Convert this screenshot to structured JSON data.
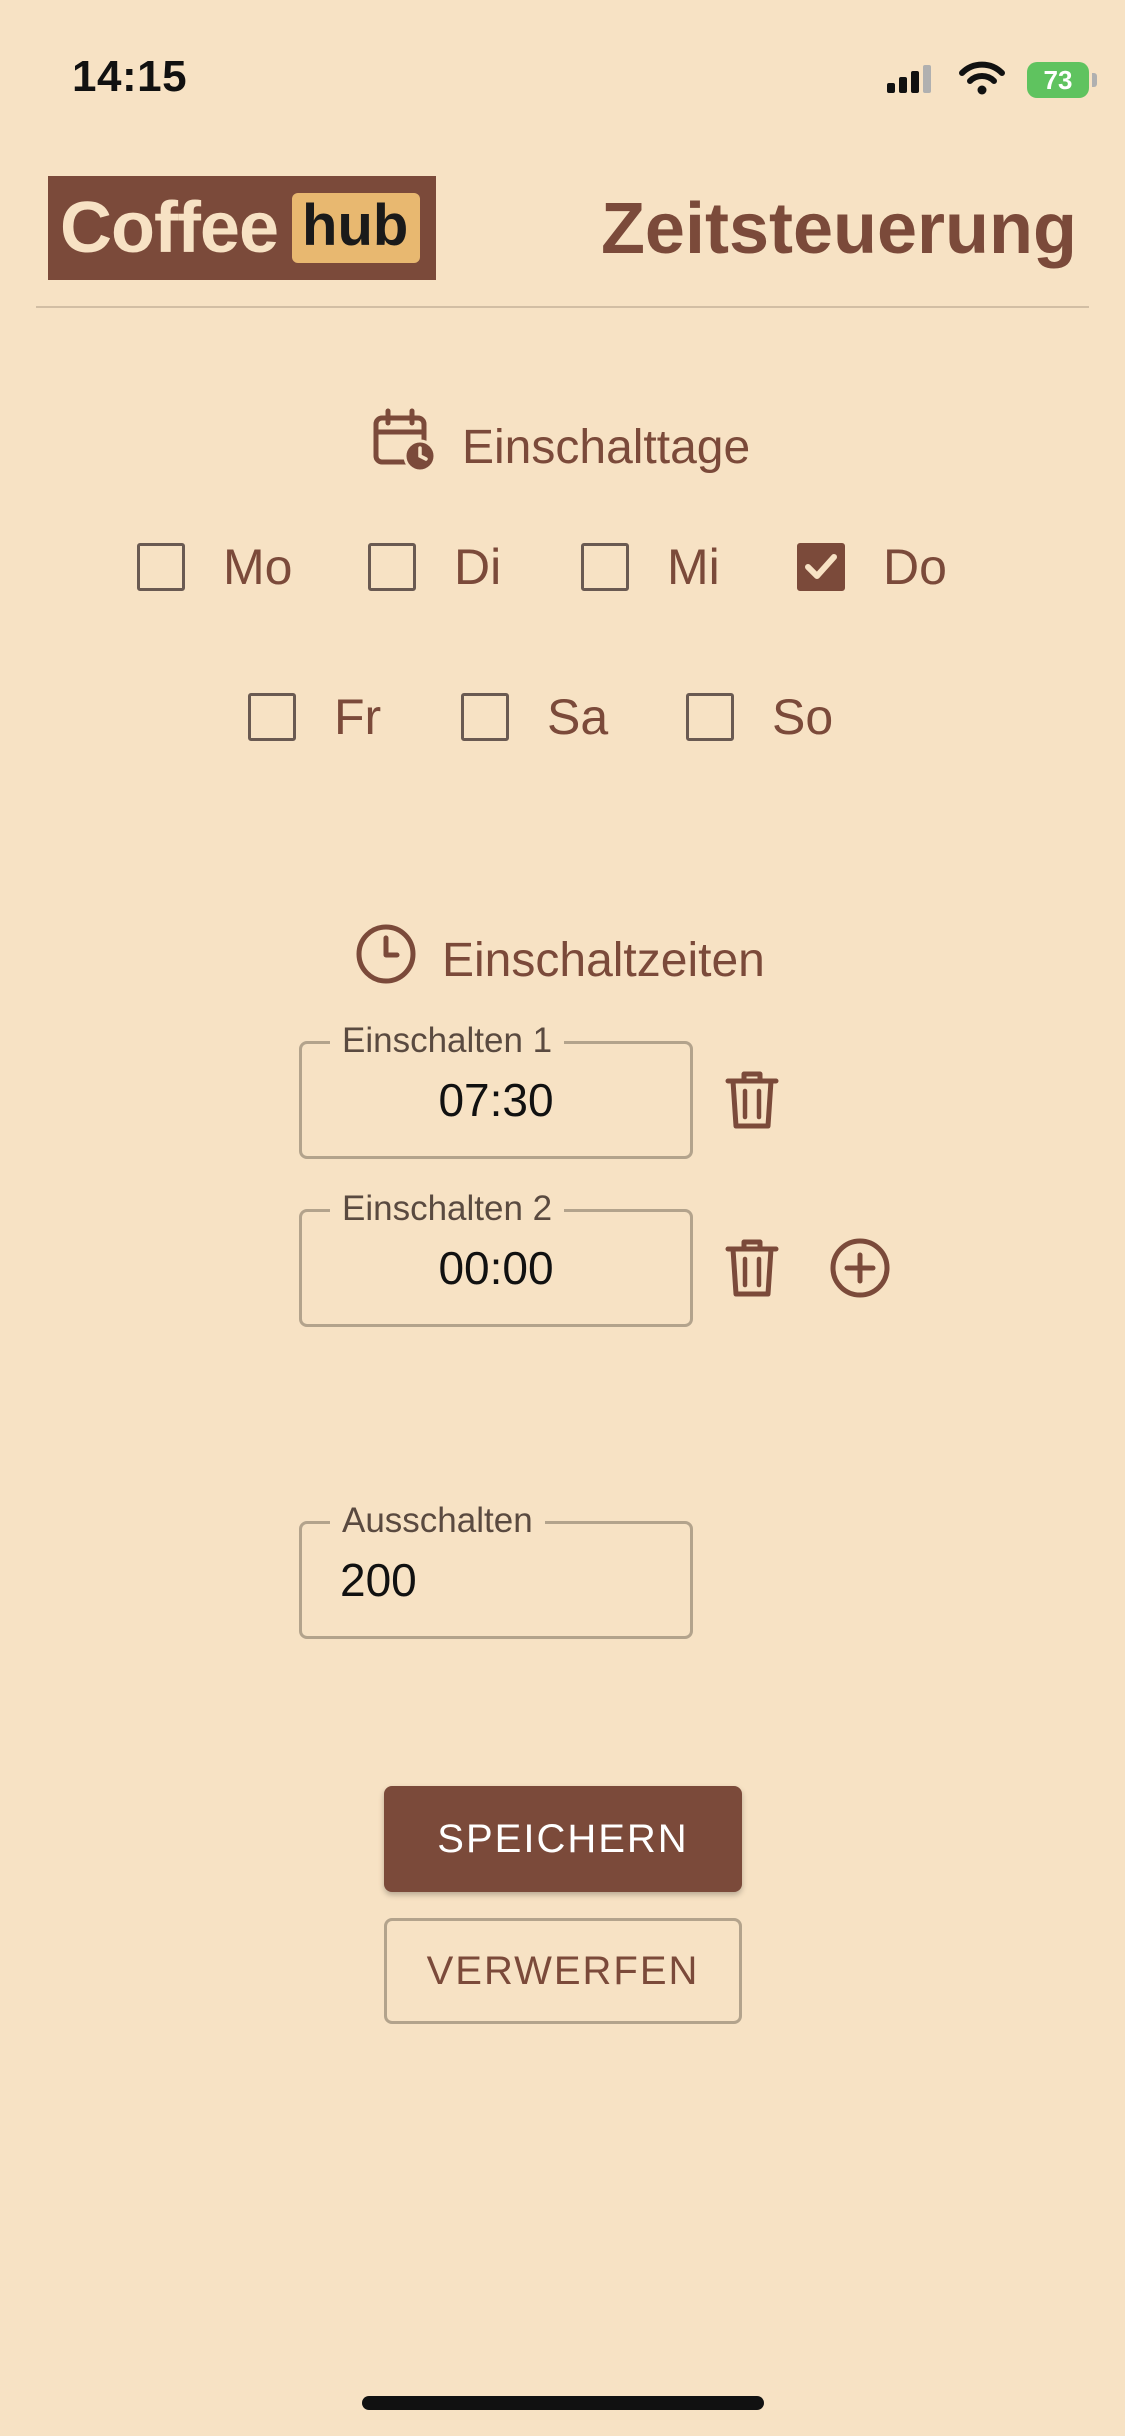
{
  "status_bar": {
    "time": "14:15",
    "battery": "73"
  },
  "header": {
    "logo_part1": "Coffee",
    "logo_part2": "hub",
    "title": "Zeitsteuerung"
  },
  "days_section": {
    "title": "Einschalttage",
    "icon": "calendar-clock-icon",
    "days": [
      {
        "label": "Mo",
        "checked": false
      },
      {
        "label": "Di",
        "checked": false
      },
      {
        "label": "Mi",
        "checked": false
      },
      {
        "label": "Do",
        "checked": true
      },
      {
        "label": "Fr",
        "checked": false
      },
      {
        "label": "Sa",
        "checked": false
      },
      {
        "label": "So",
        "checked": false
      }
    ]
  },
  "times_section": {
    "title": "Einschaltzeiten",
    "icon": "clock-icon",
    "entries": [
      {
        "label": "Einschalten 1",
        "value": "07:30"
      },
      {
        "label": "Einschalten 2",
        "value": "00:00"
      }
    ]
  },
  "off_field": {
    "label": "Ausschalten",
    "value": "200"
  },
  "actions": {
    "save_label": "SPEICHERN",
    "discard_label": "VERWERFEN"
  },
  "colors": {
    "background": "#f7e2c4",
    "brand": "#7b4a3a",
    "accent": "#e8b870",
    "battery": "#5fc35f"
  }
}
